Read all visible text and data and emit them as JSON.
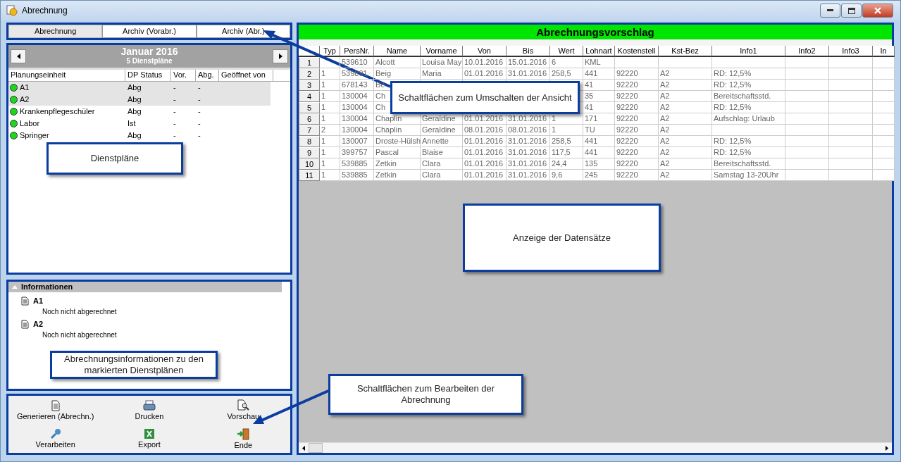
{
  "window": {
    "title": "Abrechnung"
  },
  "view_tabs": [
    {
      "label": "Abrechnung",
      "selected": true
    },
    {
      "label": "Archiv (Vorabr.)",
      "selected": false
    },
    {
      "label": "Archiv (Abr.)",
      "selected": false
    }
  ],
  "plans": {
    "month": "Januar 2016",
    "count": "5 Dienstpläne",
    "columns": [
      "Planungseinheit",
      "DP Status",
      "Vor.",
      "Abg.",
      "Geöffnet von"
    ],
    "rows": [
      {
        "cells": [
          "A1",
          "Abg",
          "-",
          "-"
        ],
        "selected": true
      },
      {
        "cells": [
          "A2",
          "Abg",
          "-",
          "-"
        ],
        "selected": true
      },
      {
        "cells": [
          "Krankenpflegeschüler",
          "Abg",
          "-",
          "-"
        ],
        "selected": false
      },
      {
        "cells": [
          "Labor",
          "Ist",
          "-",
          "-"
        ],
        "selected": false
      },
      {
        "cells": [
          "Springer",
          "Abg",
          "-",
          "-"
        ],
        "selected": false
      }
    ]
  },
  "information": {
    "title": "Informationen",
    "expanded": true,
    "entries": [
      {
        "name": "A1",
        "text": "Noch nicht abgerechnet"
      },
      {
        "name": "A2",
        "text": "Noch nicht abgerechnet"
      }
    ]
  },
  "actions": [
    {
      "label": "Generieren (Abrechn.)",
      "kind": "document"
    },
    {
      "label": "Drucken",
      "kind": "printer"
    },
    {
      "label": "Vorschau",
      "kind": "preview"
    },
    {
      "label": "Verarbeiten",
      "kind": "key"
    },
    {
      "label": "Export",
      "kind": "spreadsheet"
    },
    {
      "label": "Ende",
      "kind": "exit"
    }
  ],
  "proposal": {
    "title": "Abrechnungsvorschlag",
    "columns": [
      "Typ",
      "PersNr.",
      "Name",
      "Vorname",
      "Von",
      "Bis",
      "Wert",
      "Lohnart",
      "Kostenstell",
      "Kst-Bez",
      "Info1",
      "Info2",
      "Info3",
      "In"
    ],
    "rows": [
      {
        "number": "1",
        "cells": [
          null,
          "539610",
          "Alcott",
          "Louisa May",
          "10.01.2016",
          "15.01.2016",
          "6",
          "KML",
          null,
          null,
          null,
          null,
          null,
          null
        ]
      },
      {
        "number": "2",
        "cells": [
          "1",
          "539891",
          "Beig",
          "Maria",
          "01.01.2016",
          "31.01.2016",
          "258,5",
          "441",
          "92220",
          "A2",
          "RD: 12,5%",
          null,
          null,
          null
        ]
      },
      {
        "number": "3",
        "cells": [
          "1",
          "678143",
          "Be",
          null,
          null,
          null,
          null,
          "41",
          "92220",
          "A2",
          "RD: 12,5%",
          null,
          null,
          null
        ]
      },
      {
        "number": "4",
        "cells": [
          "1",
          "130004",
          "Ch",
          null,
          null,
          null,
          null,
          "35",
          "92220",
          "A2",
          "Bereitschaftsstd.",
          null,
          null,
          null
        ]
      },
      {
        "number": "5",
        "cells": [
          "1",
          "130004",
          "Ch",
          null,
          null,
          null,
          null,
          "41",
          "92220",
          "A2",
          "RD: 12,5%",
          null,
          null,
          null
        ]
      },
      {
        "number": "6",
        "cells": [
          "1",
          "130004",
          "Chaplin",
          "Geraldine",
          "01.01.2016",
          "31.01.2016",
          "1",
          "171",
          "92220",
          "A2",
          "Aufschlag: Urlaub",
          null,
          null,
          null
        ]
      },
      {
        "number": "7",
        "cells": [
          "2",
          "130004",
          "Chaplin",
          "Geraldine",
          "08.01.2016",
          "08.01.2016",
          "1",
          "TU",
          "92220",
          "A2",
          null,
          null,
          null,
          null
        ]
      },
      {
        "number": "8",
        "cells": [
          "1",
          "130007",
          "Droste-Hülsh",
          "Annette",
          "01.01.2016",
          "31.01.2016",
          "258,5",
          "441",
          "92220",
          "A2",
          "RD: 12,5%",
          null,
          null,
          null
        ]
      },
      {
        "number": "9",
        "cells": [
          "1",
          "399757",
          "Pascal",
          "Blaise",
          "01.01.2016",
          "31.01.2016",
          "117,5",
          "441",
          "92220",
          "A2",
          "RD: 12,5%",
          null,
          null,
          null
        ]
      },
      {
        "number": "10",
        "cells": [
          "1",
          "539885",
          "Zetkin",
          "Clara",
          "01.01.2016",
          "31.01.2016",
          "24,4",
          "135",
          "92220",
          "A2",
          "Bereitschaftsstd.",
          null,
          null,
          null
        ]
      },
      {
        "number": "11",
        "cells": [
          "1",
          "539885",
          "Zetkin",
          "Clara",
          "01.01.2016",
          "31.01.2016",
          "9,6",
          "245",
          "92220",
          "A2",
          "Samstag 13-20Uhr",
          null,
          null,
          null
        ]
      }
    ]
  },
  "annotations": [
    {
      "text": "Dienstpläne"
    },
    {
      "text": "Schaltflächen zum Umschalten der Ansicht"
    },
    {
      "text": "Anzeige der Datensätze"
    },
    {
      "text": "Abrechnungsinformationen zu den markierten Dienstplänen"
    },
    {
      "text": "Schaltflächen zum Bearbeiten der Abrechnung"
    }
  ]
}
